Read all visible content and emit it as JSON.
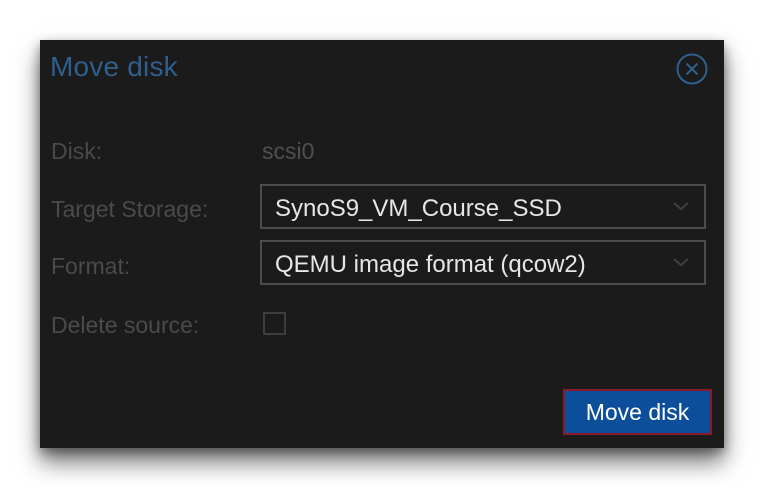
{
  "dialog": {
    "title": "Move disk",
    "close_icon": "close-circle-icon"
  },
  "form": {
    "disk": {
      "label": "Disk:",
      "value": "scsi0"
    },
    "target_storage": {
      "label": "Target Storage:",
      "value": "SynoS9_VM_Course_SSD"
    },
    "format": {
      "label": "Format:",
      "value": "QEMU image format (qcow2)"
    },
    "delete_source": {
      "label": "Delete source:",
      "checked": false
    }
  },
  "actions": {
    "move_disk_label": "Move disk"
  },
  "colors": {
    "dialog_background": "#1b1b1c",
    "title": "#2f5f8c",
    "primary_button": "#0d4e9a",
    "primary_button_border": "#8a1a2b"
  }
}
